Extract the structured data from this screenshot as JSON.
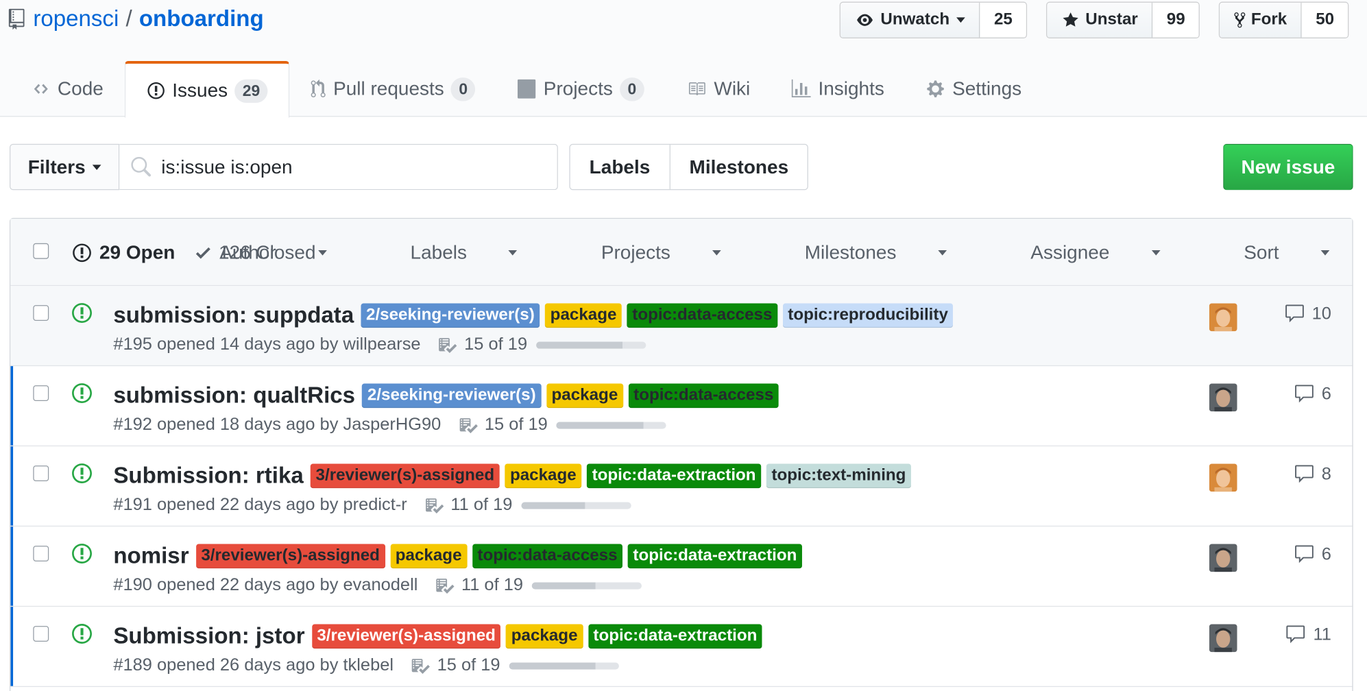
{
  "repo": {
    "owner": "ropensci",
    "name": "onboarding"
  },
  "actions": {
    "watch": {
      "label": "Unwatch",
      "count": "25"
    },
    "star": {
      "label": "Unstar",
      "count": "99"
    },
    "fork": {
      "label": "Fork",
      "count": "50"
    }
  },
  "tabs": [
    {
      "label": "Code",
      "icon": "code-icon"
    },
    {
      "label": "Issues",
      "count": "29",
      "icon": "issue-opened-icon"
    },
    {
      "label": "Pull requests",
      "count": "0",
      "icon": "pull-request-icon"
    },
    {
      "label": "Projects",
      "count": "0",
      "icon": "project-icon"
    },
    {
      "label": "Wiki",
      "icon": "book-icon"
    },
    {
      "label": "Insights",
      "icon": "graph-icon"
    },
    {
      "label": "Settings",
      "icon": "gear-icon"
    }
  ],
  "subnav": {
    "filters_label": "Filters",
    "search_value": "is:issue is:open",
    "labels_label": "Labels",
    "milestones_label": "Milestones",
    "new_issue_label": "New issue"
  },
  "list_header": {
    "open": "29 Open",
    "closed": "126 Closed",
    "menus": [
      "Author",
      "Labels",
      "Projects",
      "Milestones",
      "Assignee",
      "Sort"
    ]
  },
  "colors": {
    "seeking": "#5b8fd0",
    "assigned": "#e74c3c",
    "package": "#f5c800",
    "data_access": "#0a8a0a",
    "data_extraction": "#0a8a0a",
    "reproducibility": "#c6dcf8",
    "text_mining": "#c3dddb",
    "open_green": "#28a745",
    "link_blue": "#0366d6"
  },
  "issues": [
    {
      "title": "submission: suppdata",
      "labels": [
        {
          "text": "2/seeking-reviewer(s)",
          "bg": "#5b8fd0",
          "fg": "#ffffff"
        },
        {
          "text": "package",
          "bg": "#f5c800",
          "fg": "#24292e"
        },
        {
          "text": "topic:data-access",
          "bg": "#0a8a0a",
          "fg": "#24292e"
        },
        {
          "text": "topic:reproducibility",
          "bg": "#c6dcf8",
          "fg": "#24292e"
        }
      ],
      "meta": "#195 opened 14 days ago by willpearse",
      "progress": "15 of 19",
      "progress_fraction": 0.79,
      "avatar": "orange",
      "comments": "10"
    },
    {
      "title": "submission: qualtRics",
      "labels": [
        {
          "text": "2/seeking-reviewer(s)",
          "bg": "#5b8fd0",
          "fg": "#ffffff"
        },
        {
          "text": "package",
          "bg": "#f5c800",
          "fg": "#24292e"
        },
        {
          "text": "topic:data-access",
          "bg": "#0a8a0a",
          "fg": "#24292e"
        }
      ],
      "meta": "#192 opened 18 days ago by JasperHG90",
      "progress": "15 of 19",
      "progress_fraction": 0.79,
      "avatar": "gray",
      "comments": "6"
    },
    {
      "title": "Submission: rtika",
      "labels": [
        {
          "text": "3/reviewer(s)-assigned",
          "bg": "#e74c3c",
          "fg": "#24292e"
        },
        {
          "text": "package",
          "bg": "#f5c800",
          "fg": "#24292e"
        },
        {
          "text": "topic:data-extraction",
          "bg": "#0a8a0a",
          "fg": "#ffffff"
        },
        {
          "text": "topic:text-mining",
          "bg": "#c3dddb",
          "fg": "#24292e"
        }
      ],
      "meta": "#191 opened 22 days ago by predict-r",
      "progress": "11 of 19",
      "progress_fraction": 0.58,
      "avatar": "orange",
      "comments": "8"
    },
    {
      "title": "nomisr",
      "labels": [
        {
          "text": "3/reviewer(s)-assigned",
          "bg": "#e74c3c",
          "fg": "#24292e"
        },
        {
          "text": "package",
          "bg": "#f5c800",
          "fg": "#24292e"
        },
        {
          "text": "topic:data-access",
          "bg": "#0a8a0a",
          "fg": "#24292e"
        },
        {
          "text": "topic:data-extraction",
          "bg": "#0a8a0a",
          "fg": "#ffffff"
        }
      ],
      "meta": "#190 opened 22 days ago by evanodell",
      "progress": "11 of 19",
      "progress_fraction": 0.58,
      "avatar": "gray",
      "comments": "6"
    },
    {
      "title": "Submission: jstor",
      "labels": [
        {
          "text": "3/reviewer(s)-assigned",
          "bg": "#e74c3c",
          "fg": "#ffffff"
        },
        {
          "text": "package",
          "bg": "#f5c800",
          "fg": "#24292e"
        },
        {
          "text": "topic:data-extraction",
          "bg": "#0a8a0a",
          "fg": "#ffffff"
        }
      ],
      "meta": "#189 opened 26 days ago by tklebel",
      "progress": "15 of 19",
      "progress_fraction": 0.79,
      "avatar": "gray",
      "comments": "11"
    }
  ]
}
